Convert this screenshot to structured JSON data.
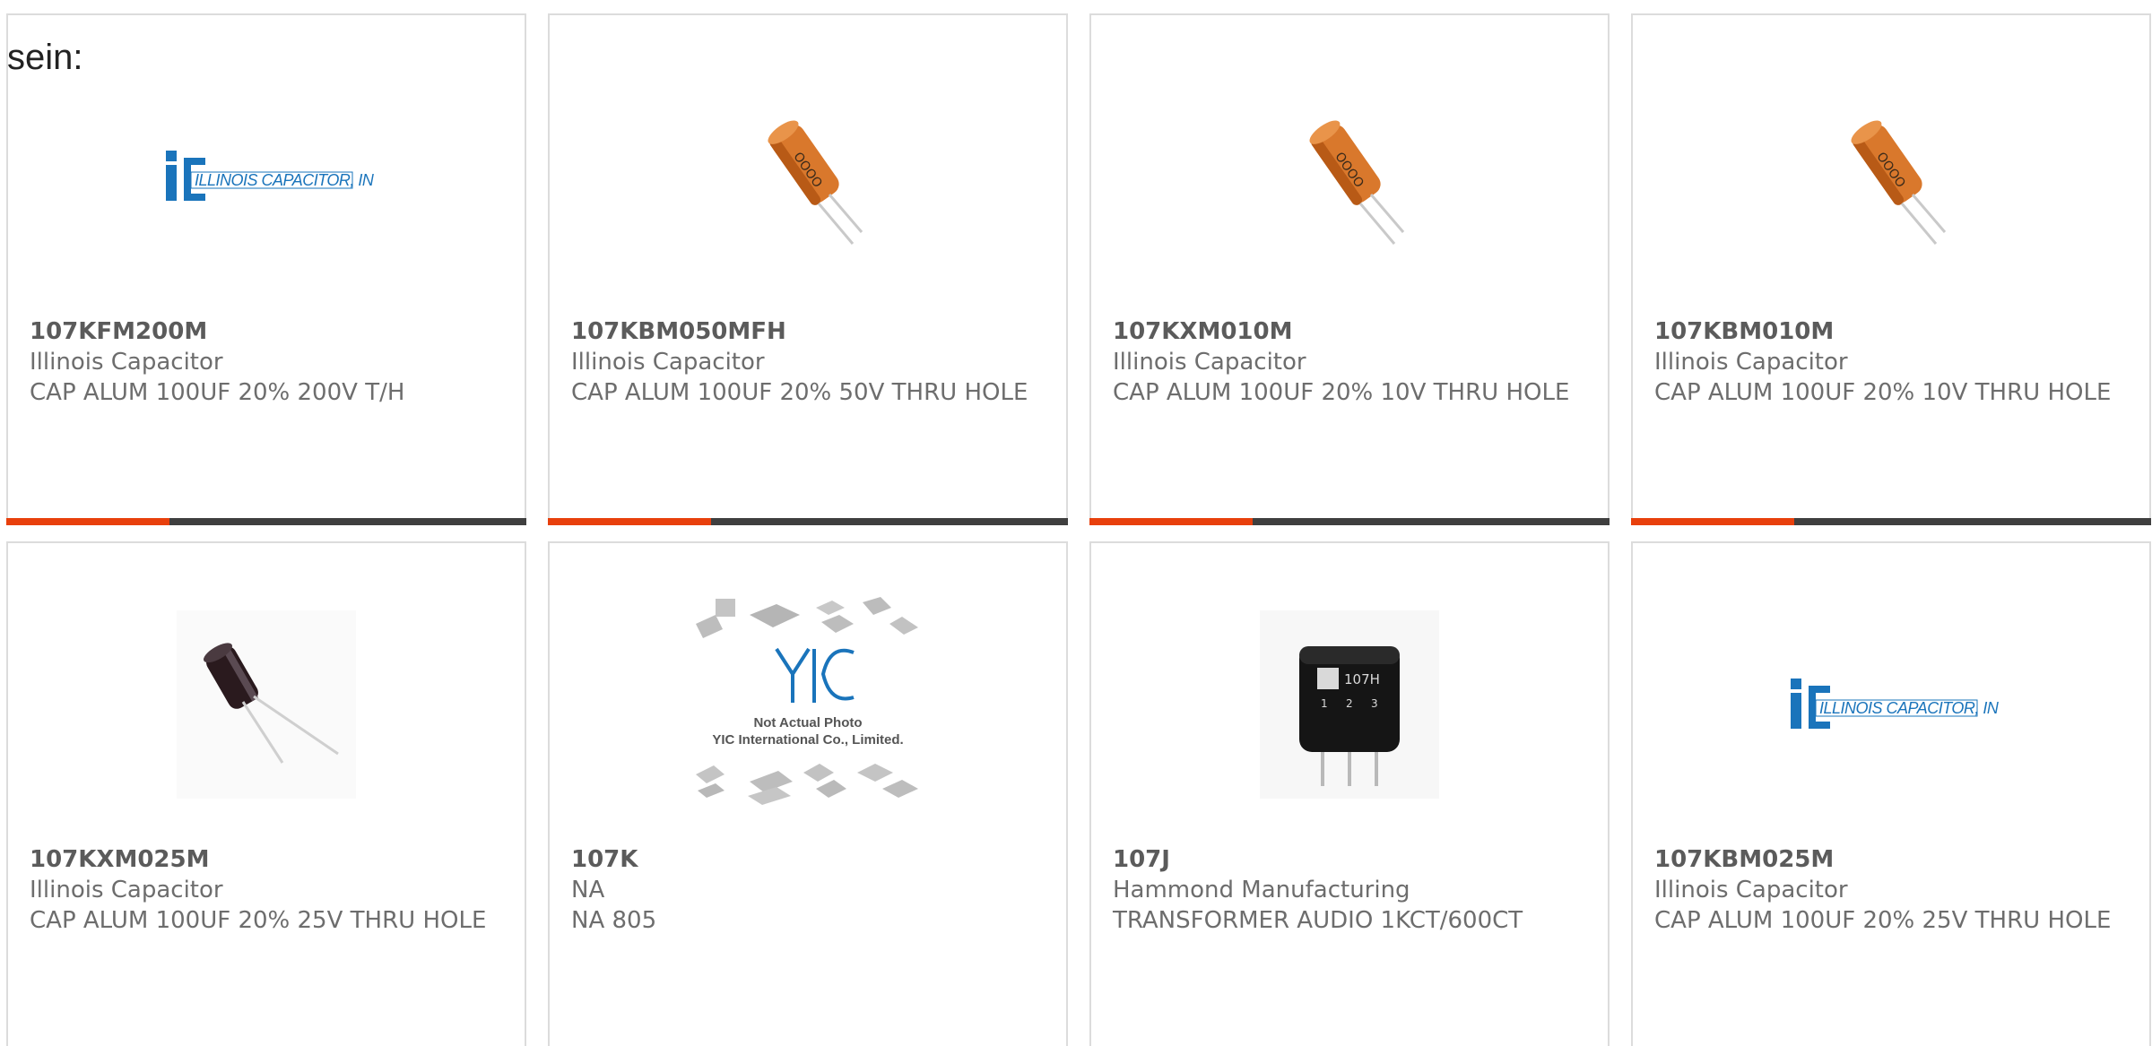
{
  "intro_text": "sein:",
  "colors": {
    "accent": "#e8400c",
    "bar": "#3f3f3f",
    "logo_blue": "#1a74bb"
  },
  "logo": {
    "mark": "iC",
    "text": "ILLINOIS CAPACITOR, INC."
  },
  "yic": {
    "mark": "YIC",
    "line1": "Not Actual Photo",
    "line2": "YIC International Co., Limited."
  },
  "transformer_marking": {
    "model": "107H",
    "pins": [
      "1",
      "2",
      "3"
    ]
  },
  "products": [
    {
      "part": "107KFM200M",
      "maker": "Illinois Capacitor",
      "desc": "CAP ALUM 100UF 20% 200V T/H",
      "image": "illinois-capacitor-logo",
      "has_bar": true
    },
    {
      "part": "107KBM050MFH",
      "maker": "Illinois Capacitor",
      "desc": "CAP ALUM 100UF 20% 50V THRU HOLE",
      "image": "orange-capacitor-photo",
      "has_bar": true
    },
    {
      "part": "107KXM010M",
      "maker": "Illinois Capacitor",
      "desc": "CAP ALUM 100UF 20% 10V THRU HOLE",
      "image": "orange-capacitor-photo",
      "has_bar": true
    },
    {
      "part": "107KBM010M",
      "maker": "Illinois Capacitor",
      "desc": "CAP ALUM 100UF 20% 10V THRU HOLE",
      "image": "orange-capacitor-photo",
      "has_bar": true
    },
    {
      "part": "107KXM025M",
      "maker": "Illinois Capacitor",
      "desc": "CAP ALUM 100UF 20% 25V THRU HOLE",
      "image": "black-capacitor-photo",
      "has_bar": false
    },
    {
      "part": "107K",
      "maker": "NA",
      "desc": "NA 805",
      "image": "yic-placeholder",
      "has_bar": false
    },
    {
      "part": "107J",
      "maker": "Hammond Manufacturing",
      "desc": "TRANSFORMER AUDIO 1KCT/600CT",
      "image": "transformer-photo",
      "has_bar": false
    },
    {
      "part": "107KBM025M",
      "maker": "Illinois Capacitor",
      "desc": "CAP ALUM 100UF 20% 25V THRU HOLE",
      "image": "illinois-capacitor-logo",
      "has_bar": false
    }
  ]
}
